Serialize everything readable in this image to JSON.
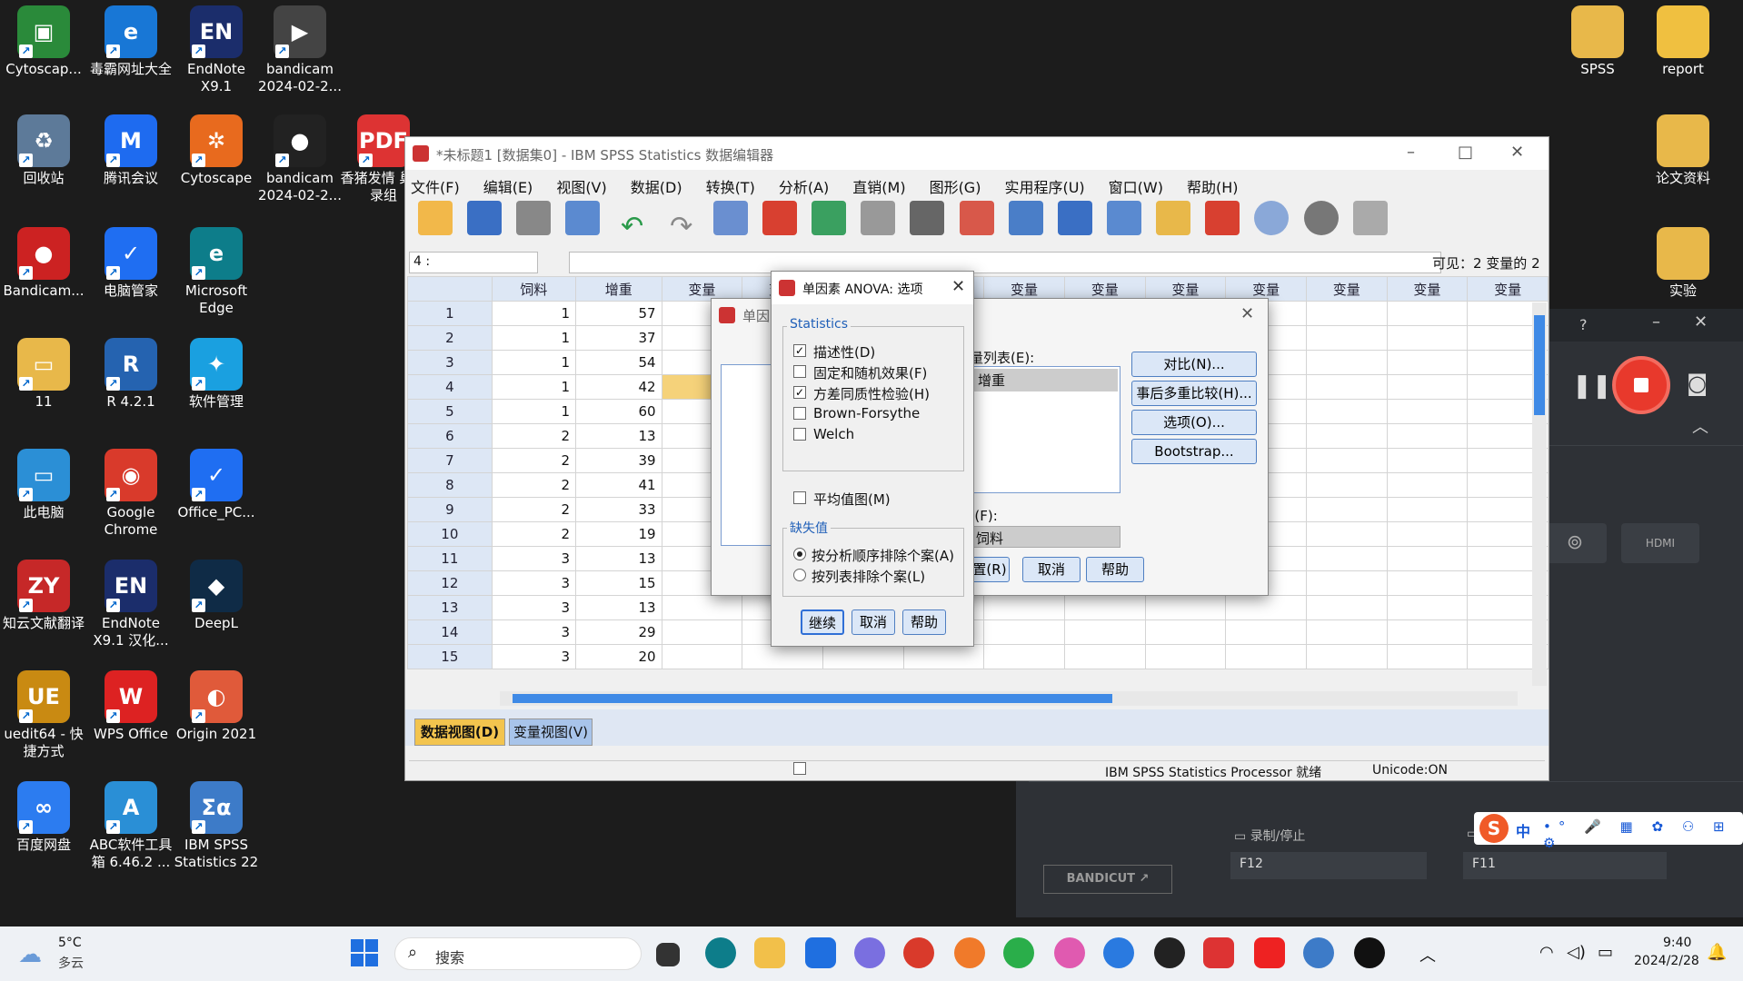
{
  "desktop": {
    "icons_left": [
      {
        "label": "Cytoscap...",
        "color": "#2a8a3a",
        "glyph": "▣"
      },
      {
        "label": "毒霸网址大全",
        "color": "#1877d6",
        "glyph": "e"
      },
      {
        "label": "EndNote X9.1",
        "color": "#1b2d6b",
        "glyph": "EN"
      },
      {
        "label": "bandicam 2024-02-2...",
        "color": "#444",
        "glyph": "▶"
      },
      {
        "label": "回收站",
        "color": "#5d7a99",
        "glyph": "♻"
      },
      {
        "label": "腾讯会议",
        "color": "#1e6bf0",
        "glyph": "M"
      },
      {
        "label": "Cytoscape",
        "color": "#e86a1e",
        "glyph": "✲"
      },
      {
        "label": "bandicam 2024-02-2...",
        "color": "#222",
        "glyph": "●"
      },
      {
        "label": "香猪发情 巢转录组",
        "color": "#d33",
        "glyph": "PDF"
      },
      {
        "label": "Bandicam...",
        "color": "#c22",
        "glyph": "●"
      },
      {
        "label": "电脑管家",
        "color": "#1f6ef2",
        "glyph": "✓"
      },
      {
        "label": "Microsoft Edge",
        "color": "#0d7d8a",
        "glyph": "e"
      },
      {
        "label": "11",
        "color": "#e8b84a",
        "glyph": "▭"
      },
      {
        "label": "R 4.2.1",
        "color": "#2563b0",
        "glyph": "R"
      },
      {
        "label": "软件管理",
        "color": "#1aa0e0",
        "glyph": "✦"
      },
      {
        "label": "此电脑",
        "color": "#2b8fd6",
        "glyph": "▭"
      },
      {
        "label": "Google Chrome",
        "color": "#d93a2b",
        "glyph": "◉"
      },
      {
        "label": "Office_PC...",
        "color": "#1f6ef2",
        "glyph": "✓"
      },
      {
        "label": "知云文献翻译",
        "color": "#c62828",
        "glyph": "ZY"
      },
      {
        "label": "EndNote X9.1 汉化...",
        "color": "#1b2d6b",
        "glyph": "EN"
      },
      {
        "label": "DeepL",
        "color": "#0f2b46",
        "glyph": "◆"
      },
      {
        "label": "uedit64 - 快捷方式",
        "color": "#c98a12",
        "glyph": "UE"
      },
      {
        "label": "WPS Office",
        "color": "#d22",
        "glyph": "W"
      },
      {
        "label": "Origin 2021",
        "color": "#e05a3a",
        "glyph": "◐"
      },
      {
        "label": "百度网盘",
        "color": "#2c7cf0",
        "glyph": "∞"
      },
      {
        "label": "ABC软件工具 箱 6.46.2 ...",
        "color": "#2a8fd6",
        "glyph": "A"
      },
      {
        "label": "IBM SPSS Statistics 22",
        "color": "#3d7bc8",
        "glyph": "Σα"
      }
    ],
    "icons_right": [
      {
        "label": "SPSS",
        "color": "#e8b84a"
      },
      {
        "label": "report",
        "color": "#f0c040"
      },
      {
        "label": "论文资料",
        "color": "#e8b84a"
      },
      {
        "label": "实验",
        "color": "#e8b84a"
      }
    ]
  },
  "spss": {
    "title": "*未标题1 [数据集0] - IBM SPSS Statistics 数据编辑器",
    "menus": [
      "文件(F)",
      "编辑(E)",
      "视图(V)",
      "数据(D)",
      "转换(T)",
      "分析(A)",
      "直销(M)",
      "图形(G)",
      "实用程序(U)",
      "窗口(W)",
      "帮助(H)"
    ],
    "cell_ref": "4 :",
    "visible_vars": "可见：2 变量的 2",
    "columns": [
      "饲料",
      "增重",
      "变量",
      "变量",
      "变量",
      "变量",
      "变量",
      "变量",
      "变量",
      "变量",
      "变量",
      "变量",
      "变量"
    ],
    "rows": [
      {
        "n": "1",
        "a": "1",
        "b": "57"
      },
      {
        "n": "2",
        "a": "1",
        "b": "37"
      },
      {
        "n": "3",
        "a": "1",
        "b": "54"
      },
      {
        "n": "4",
        "a": "1",
        "b": "42"
      },
      {
        "n": "5",
        "a": "1",
        "b": "60"
      },
      {
        "n": "6",
        "a": "2",
        "b": "13"
      },
      {
        "n": "7",
        "a": "2",
        "b": "39"
      },
      {
        "n": "8",
        "a": "2",
        "b": "41"
      },
      {
        "n": "9",
        "a": "2",
        "b": "33"
      },
      {
        "n": "10",
        "a": "2",
        "b": "19"
      },
      {
        "n": "11",
        "a": "3",
        "b": "13"
      },
      {
        "n": "12",
        "a": "3",
        "b": "15"
      },
      {
        "n": "13",
        "a": "3",
        "b": "13"
      },
      {
        "n": "14",
        "a": "3",
        "b": "29"
      },
      {
        "n": "15",
        "a": "3",
        "b": "20"
      }
    ],
    "tabs": [
      "数据视图(D)",
      "变量视图(V)"
    ],
    "status": "IBM SPSS Statistics Processor 就绪",
    "unicode": "Unicode:ON"
  },
  "anova_dialog": {
    "title": "单因",
    "dep_list_label": "量列表(E):",
    "dep_value": "增重",
    "factor_label": "-(F):",
    "factor_value": "饲料",
    "buttons": [
      "对比(N)...",
      "事后多重比较(H)...",
      "选项(O)...",
      "Bootstrap..."
    ],
    "bottom_buttons": [
      "置(R)",
      "取消",
      "帮助"
    ]
  },
  "options_dialog": {
    "title": "单因素 ANOVA: 选项",
    "statistics_group": "Statistics",
    "checks": [
      {
        "label": "描述性(D)",
        "checked": true
      },
      {
        "label": "固定和随机效果(F)",
        "checked": false
      },
      {
        "label": "方差同质性检验(H)",
        "checked": true
      },
      {
        "label": "Brown-Forsythe",
        "checked": false
      },
      {
        "label": "Welch",
        "checked": false
      }
    ],
    "means_plot": "平均值图(M)",
    "missing_group": "缺失值",
    "radios": [
      {
        "label": "按分析顺序排除个案(A)",
        "selected": true
      },
      {
        "label": "按列表排除个案(L)",
        "selected": false
      }
    ],
    "buttons": [
      "继续",
      "取消",
      "帮助"
    ]
  },
  "bandicam": {
    "record_label": "录制/停止",
    "record_key": "F12",
    "key2": "F11",
    "brand": "BANDICUT ↗"
  },
  "taskbar": {
    "temp": "5°C",
    "weather": "多云",
    "search": "搜索",
    "ime": "中",
    "time": "9:40",
    "date": "2024/2/28"
  }
}
